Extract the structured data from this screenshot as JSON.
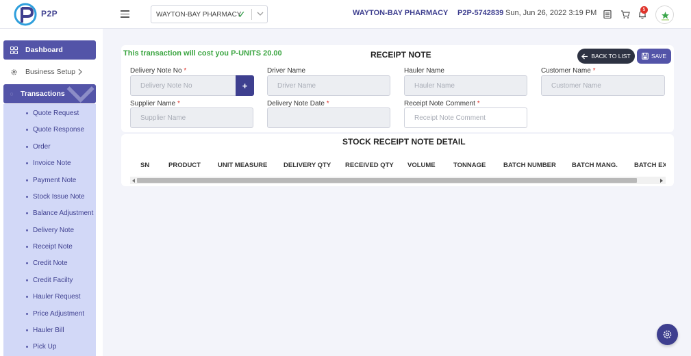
{
  "header": {
    "logo_text": "P2P",
    "organization_select": {
      "value": "WAYTON-BAY PHARMACY"
    },
    "organization_name": "WAYTON-BAY PHARMACY",
    "account_id": "P2P-5742839",
    "datetime": "Sun, Jun 26, 2022 3:19 PM",
    "notification_count": "5"
  },
  "sidebar": {
    "dashboard": "Dashboard",
    "business_setup": "Business Setup",
    "transactions": "Transactions",
    "transaction_items": [
      "Quote Request",
      "Quote Response",
      "Order",
      "Invoice Note",
      "Payment Note",
      "Stock Issue Note",
      "Balance Adjustment",
      "Delivery Note",
      "Receipt Note",
      "Credit Note",
      "Credit Facilty",
      "Hauler Request",
      "Price Adjustment",
      "Hauler Bill",
      "Pick Up"
    ]
  },
  "form": {
    "cost_note": "This transaction will cost you P-UNITS 20.00",
    "title": "RECEIPT NOTE",
    "back_button": "BACK TO LIST",
    "save_button": "SAVE",
    "plus_label": "+",
    "required_mark": "*",
    "fields": {
      "delivery_note_no": {
        "label": "Delivery Note No",
        "placeholder": "Delivery Note No"
      },
      "driver_name": {
        "label": "Driver Name",
        "placeholder": "Driver Name"
      },
      "hauler_name": {
        "label": "Hauler Name",
        "placeholder": "Hauler Name"
      },
      "customer_name": {
        "label": "Customer Name",
        "placeholder": "Customer Name"
      },
      "supplier_name": {
        "label": "Supplier Name",
        "placeholder": "Supplier Name"
      },
      "delivery_note_date": {
        "label": "Delivery Note Date",
        "placeholder": ""
      },
      "receipt_note_comment": {
        "label": "Receipt Note Comment",
        "placeholder": "Receipt Note Comment"
      }
    }
  },
  "detail": {
    "title": "STOCK RECEIPT NOTE DETAIL",
    "columns": [
      "SN",
      "PRODUCT",
      "UNIT MEASURE",
      "DELIVERY QTY",
      "RECEIVED QTY",
      "VOLUME",
      "TONNAGE",
      "BATCH NUMBER",
      "BATCH MANG.",
      "BATCH EXPIRY"
    ]
  },
  "colors": {
    "primary": "#5354a8",
    "dark_primary": "#3e3f8f",
    "success": "#3ba541",
    "danger": "#e0342c",
    "sub_panel": "#d2d8f7"
  }
}
